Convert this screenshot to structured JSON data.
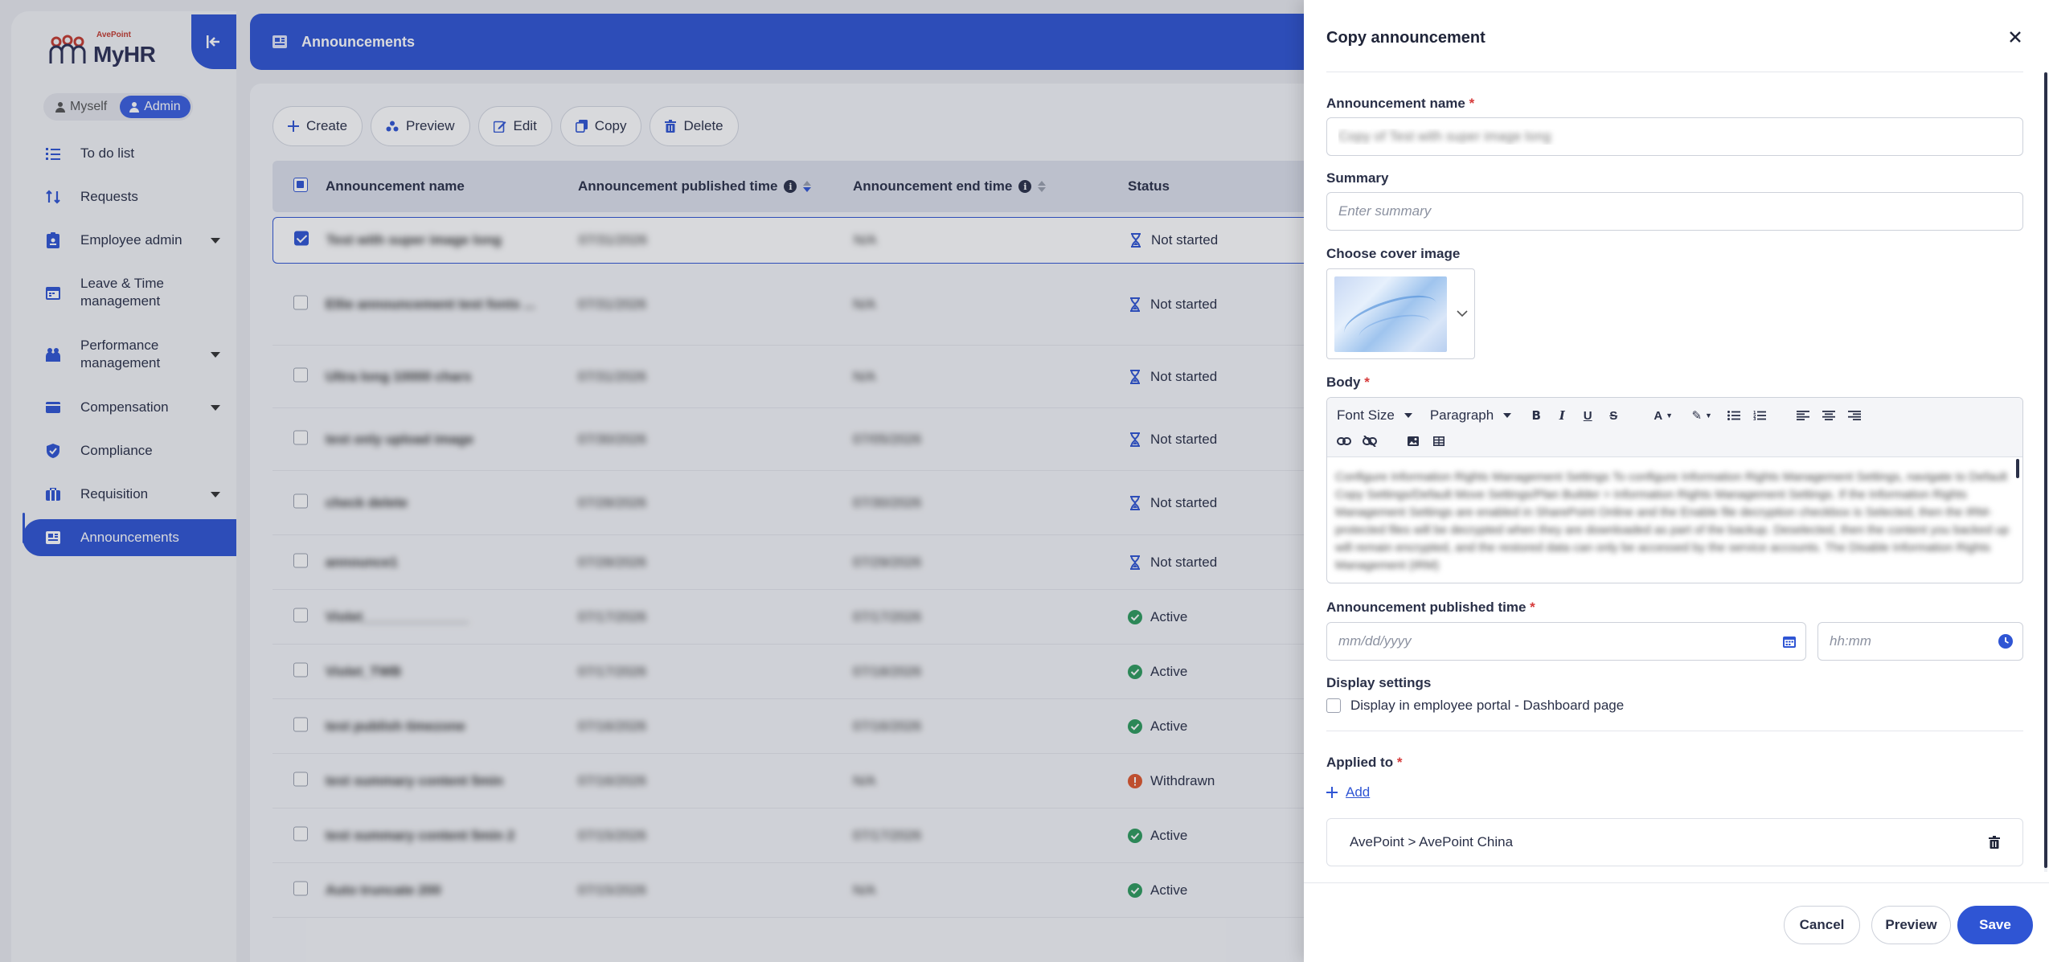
{
  "app": {
    "brand": "AvePoint",
    "name": "MyHR",
    "roles": [
      "Myself",
      "Admin"
    ],
    "active_role": "Admin"
  },
  "sidebar": {
    "items": [
      {
        "label": "To do list",
        "icon": "checklist-icon"
      },
      {
        "label": "Requests",
        "icon": "requests-icon"
      },
      {
        "label": "Employee admin",
        "icon": "employee-icon",
        "has_children": true
      },
      {
        "label": "Leave & Time\nmanagement",
        "icon": "calendar-icon"
      },
      {
        "label": "Performance\nmanagement",
        "icon": "performance-icon",
        "has_children": true
      },
      {
        "label": "Compensation",
        "icon": "wallet-icon",
        "has_children": true
      },
      {
        "label": "Compliance",
        "icon": "compliance-icon"
      },
      {
        "label": "Requisition",
        "icon": "briefcase-icon",
        "has_children": true
      },
      {
        "label": "Announcements",
        "icon": "announcement-icon",
        "active": true
      }
    ]
  },
  "header": {
    "title": "Announcements"
  },
  "toolbar": {
    "create": "Create",
    "preview": "Preview",
    "edit": "Edit",
    "copy": "Copy",
    "delete": "Delete"
  },
  "table": {
    "columns": {
      "name": "Announcement name",
      "published": "Announcement published time",
      "end": "Announcement end time",
      "status": "Status"
    },
    "rows": [
      {
        "name": "Test with super image long",
        "published": "07/31/2026",
        "end": "N/A",
        "status": "Not started",
        "selected": true
      },
      {
        "name": "Ellie announcement test fonts ...",
        "published": "07/31/2026",
        "end": "N/A",
        "status": "Not started"
      },
      {
        "name": "Ultra long 10000 chars",
        "published": "07/31/2026",
        "end": "N/A",
        "status": "Not started"
      },
      {
        "name": "test only upload image",
        "published": "07/30/2026",
        "end": "07/05/2026",
        "status": "Not started"
      },
      {
        "name": "check delete",
        "published": "07/28/2026",
        "end": "07/30/2026",
        "status": "Not started"
      },
      {
        "name": "announce1",
        "published": "07/28/2026",
        "end": "07/29/2026",
        "status": "Not started"
      },
      {
        "name": "Violet______________",
        "published": "07/17/2026",
        "end": "07/17/2026",
        "status": "Active"
      },
      {
        "name": "Violet_TWB",
        "published": "07/17/2026",
        "end": "07/18/2026",
        "status": "Active"
      },
      {
        "name": "test publish timezone",
        "published": "07/16/2026",
        "end": "07/16/2026",
        "status": "Active"
      },
      {
        "name": "test summary content 5min",
        "published": "07/16/2026",
        "end": "N/A",
        "status": "Withdrawn"
      },
      {
        "name": "test summary content 5min 2",
        "published": "07/15/2026",
        "end": "07/17/2026",
        "status": "Active"
      },
      {
        "name": "Auto truncate 200",
        "published": "07/15/2026",
        "end": "N/A",
        "status": "Active"
      }
    ]
  },
  "panel": {
    "title": "Copy announcement",
    "name_label": "Announcement name",
    "name_value": "Copy of Test with super image long",
    "summary_label": "Summary",
    "summary_placeholder": "Enter summary",
    "cover_label": "Choose cover image",
    "body_label": "Body",
    "editor": {
      "font_size": "Font Size",
      "paragraph": "Paragraph",
      "body_text": "Configure Information Rights Management Settings To configure Information Rights Management Settings, navigate to Default Copy Settings/Default Move Settings/Plan Builder > Information Rights Management Settings. If the Information Rights Management Settings are enabled in SharePoint Online and the Enable file decryption checkbox is Selected, then the IRM-protected files will be decrypted when they are downloaded as part of the backup. Deselected, then the content you backed up will remain encrypted, and the restored data can only be accessed by the service accounts. The Disable Information Rights Management (IRM)"
    },
    "published_label": "Announcement published time",
    "date_placeholder": "mm/dd/yyyy",
    "time_placeholder": "hh:mm",
    "display_label": "Display settings",
    "display_option": "Display in employee portal - Dashboard page",
    "applied_label": "Applied to",
    "add_label": "Add",
    "applied_items": [
      "AvePoint > AvePoint China"
    ],
    "buttons": {
      "cancel": "Cancel",
      "preview": "Preview",
      "save": "Save"
    }
  },
  "colors": {
    "primary": "#2f55d4",
    "active_green": "#2e9b5d",
    "withdrawn_orange": "#e0572d",
    "required_red": "#d63a3a"
  }
}
